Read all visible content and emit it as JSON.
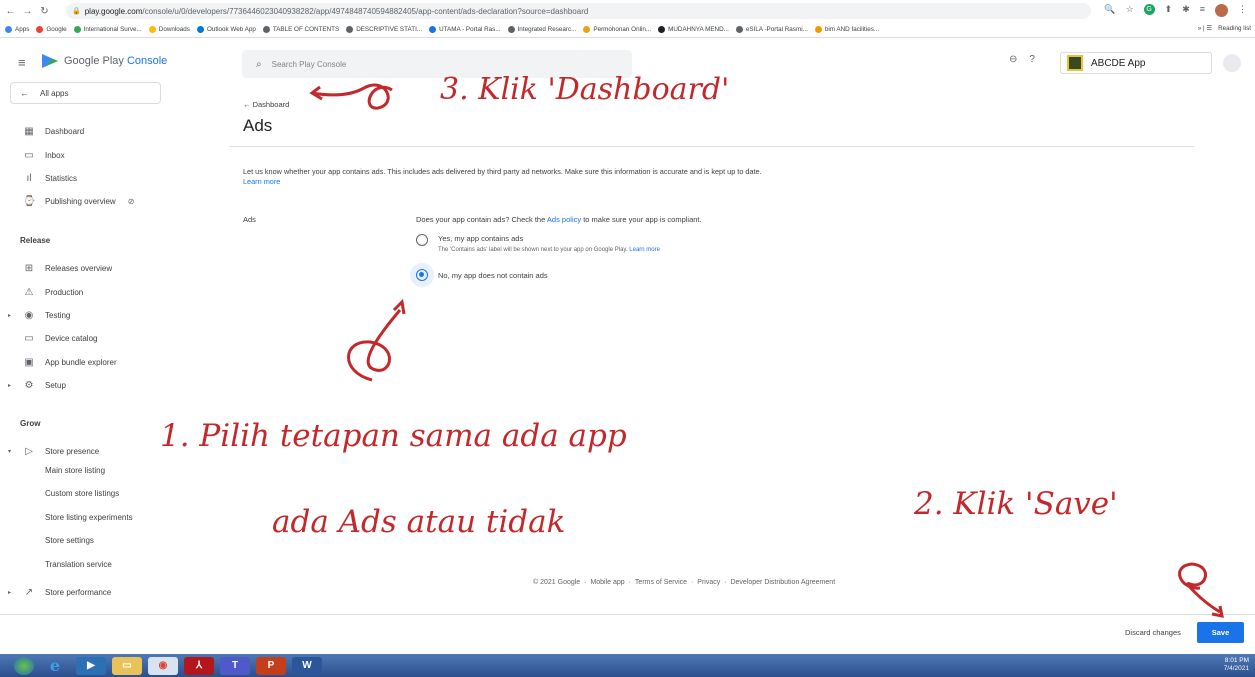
{
  "browser": {
    "url_host": "play.google.com",
    "url_path": "/console/u/0/developers/7736446023040938282/app/4974848740594882405/app-content/ads-declaration?source=dashboard",
    "bookmarks": [
      "Apps",
      "Google",
      "International Surve...",
      "Downloads",
      "Outlook Web App",
      "TABLE OF CONTENTS",
      "DESCRIPTIVE STATI...",
      "UTAMA - Portal Ras...",
      "Integrated Researc...",
      "Permohonan Onlin...",
      "MUDAHNYA MEND...",
      "eSILA -Portal Rasmi...",
      "bim AND facilities..."
    ],
    "reading_list": "Reading list"
  },
  "header": {
    "logo_text": "Google Play",
    "logo_accent": "Console",
    "search_placeholder": "Search Play Console",
    "app_name": "ABCDE App"
  },
  "sidebar": {
    "all_apps": "All apps",
    "items_top": [
      {
        "label": "Dashboard",
        "icon": "dashboard-icon",
        "glyph": "▦"
      },
      {
        "label": "Inbox",
        "icon": "inbox-icon",
        "glyph": "▭"
      },
      {
        "label": "Statistics",
        "icon": "statistics-icon",
        "glyph": "ıl"
      },
      {
        "label": "Publishing overview",
        "icon": "publishing-icon",
        "glyph": "⌚"
      }
    ],
    "release_label": "Release",
    "release_items": [
      {
        "label": "Releases overview",
        "icon": "releases-icon",
        "glyph": "⊞"
      },
      {
        "label": "Production",
        "icon": "production-icon",
        "glyph": "⚠"
      },
      {
        "label": "Testing",
        "icon": "testing-icon",
        "glyph": "◉"
      },
      {
        "label": "Device catalog",
        "icon": "device-icon",
        "glyph": "▭"
      },
      {
        "label": "App bundle explorer",
        "icon": "bundle-icon",
        "glyph": "▣"
      },
      {
        "label": "Setup",
        "icon": "setup-icon",
        "glyph": "⚙"
      }
    ],
    "grow_label": "Grow",
    "store_presence": "Store presence",
    "store_sub": [
      "Main store listing",
      "Custom store listings",
      "Store listing experiments",
      "Store settings",
      "Translation service"
    ],
    "store_performance": "Store performance"
  },
  "main": {
    "back_link": "Dashboard",
    "title": "Ads",
    "description": "Let us know whether your app contains ads. This includes ads delivered by third party ad networks. Make sure this information is accurate and is kept up to date.",
    "learn_more": "Learn more",
    "ads_label": "Ads",
    "question_pre": "Does your app contain ads? Check the",
    "ads_policy": "Ads policy",
    "question_post": "to make sure your app is compliant.",
    "option_yes": "Yes, my app contains ads",
    "option_yes_help": "The 'Contains ads' label will be shown next to your app on Google Play.",
    "option_yes_learn": "Learn more",
    "option_no": "No, my app does not contain ads",
    "selected": "no"
  },
  "footer": {
    "copyright": "© 2021 Google",
    "links": [
      "Mobile app",
      "Terms of Service",
      "Privacy",
      "Developer Distribution Agreement"
    ]
  },
  "actions": {
    "discard": "Discard changes",
    "save": "Save"
  },
  "taskbar": {
    "time": "8:01 PM",
    "date": "7/4/2021"
  },
  "annotations": {
    "step1_line1": "1. Pilih tetapan sama ada app",
    "step1_line2": "ada Ads atau tidak",
    "step2": "2. Klik 'Save'",
    "step3": "3. Klik 'Dashboard'"
  },
  "colors": {
    "accent": "#1a73e8",
    "annotation": "#c3282b"
  }
}
